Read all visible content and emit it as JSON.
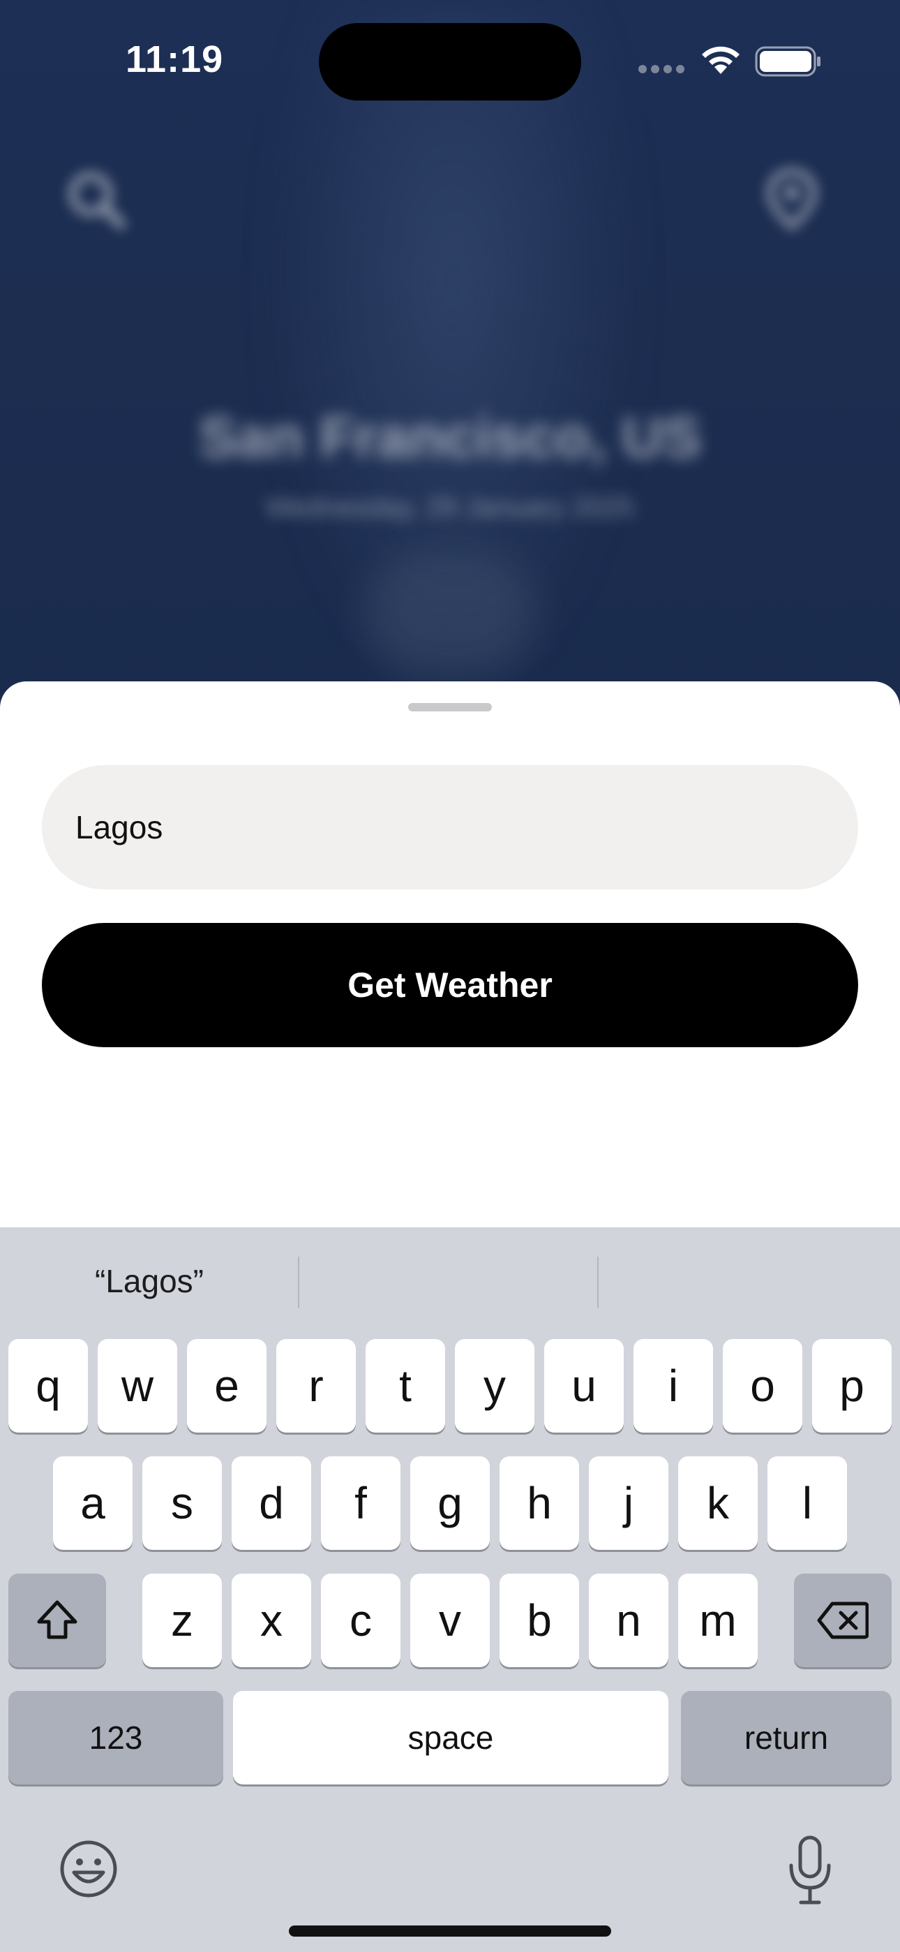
{
  "status_bar": {
    "time": "11:19"
  },
  "background": {
    "city": "San Francisco, US",
    "date": "Wednesday, 29 January 2025"
  },
  "search_sheet": {
    "city_input_value": "Lagos",
    "button_label": "Get Weather"
  },
  "keyboard": {
    "suggestions": [
      "“Lagos”",
      "",
      ""
    ],
    "row1": [
      "q",
      "w",
      "e",
      "r",
      "t",
      "y",
      "u",
      "i",
      "o",
      "p"
    ],
    "row2": [
      "a",
      "s",
      "d",
      "f",
      "g",
      "h",
      "j",
      "k",
      "l"
    ],
    "row3": [
      "z",
      "x",
      "c",
      "v",
      "b",
      "n",
      "m"
    ],
    "numbers_label": "123",
    "space_label": "space",
    "return_label": "return"
  },
  "colors": {
    "background": "#1c2d50",
    "sheet": "#ffffff",
    "input": "#f1f0ef",
    "button": "#000000",
    "keyboard": "#d1d4db",
    "key": "#ffffff",
    "key_dark": "#abb0ba"
  },
  "icons": [
    "search-icon",
    "location-pin-icon",
    "wifi-icon",
    "battery-icon",
    "shift-icon",
    "delete-icon",
    "emoji-icon",
    "microphone-icon"
  ]
}
